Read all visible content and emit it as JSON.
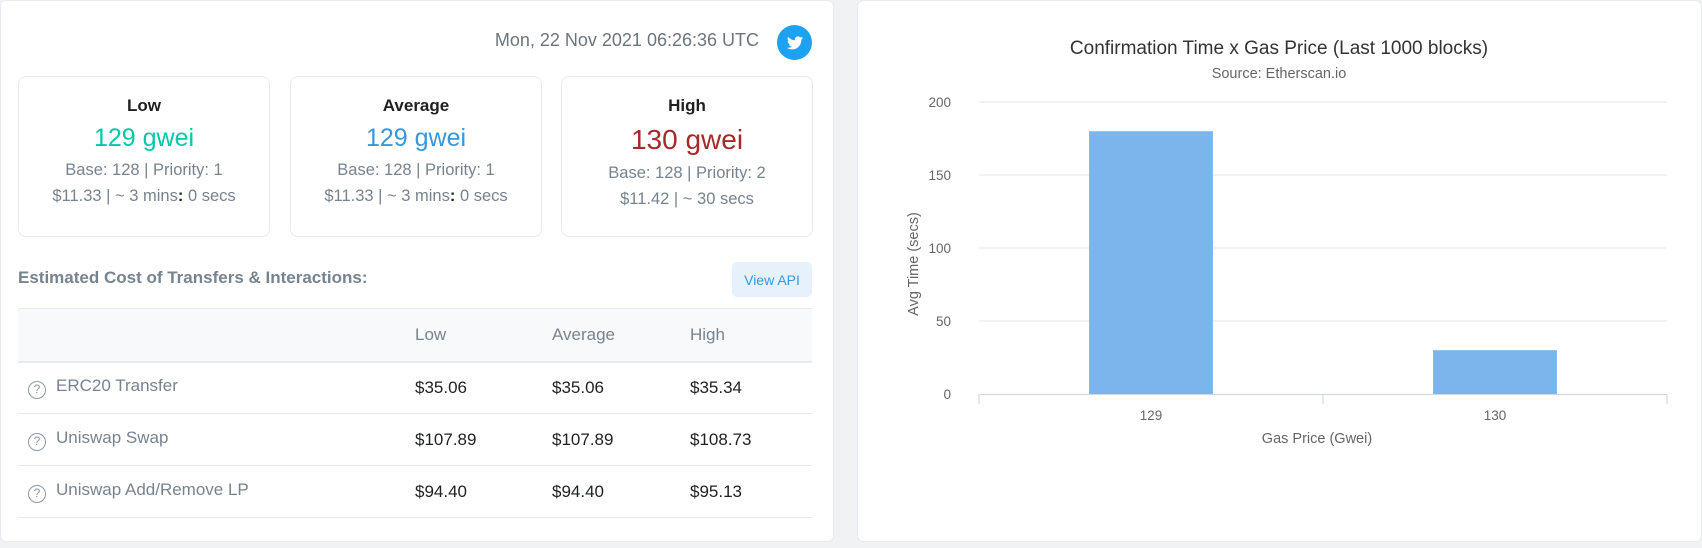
{
  "header": {
    "timestamp": "Mon, 22 Nov 2021 06:26:36 UTC",
    "twitter_icon": "twitter-icon"
  },
  "cards": [
    {
      "title": "Low",
      "value": "129 gwei",
      "detail1": "Base: 128 | Priority: 1",
      "detail2_prefix": "$11.33 | ~ 3 mins",
      "detail2_sep": ":",
      "detail2_suffix": " 0 secs",
      "color": "#00c9a7"
    },
    {
      "title": "Average",
      "value": "129 gwei",
      "detail1": "Base: 128 | Priority: 1",
      "detail2_prefix": "$11.33 | ~ 3 mins",
      "detail2_sep": ":",
      "detail2_suffix": " 0 secs",
      "color": "#3498db"
    },
    {
      "title": "High",
      "value": "130 gwei",
      "detail1": "Base: 128 | Priority: 2",
      "detail2_prefix": "$11.42 | ~ 30 secs",
      "detail2_sep": "",
      "detail2_suffix": "",
      "color": "#a52a2a"
    }
  ],
  "costs": {
    "title": "Estimated Cost of Transfers & Interactions:",
    "api_button": "View API",
    "columns": [
      "",
      "Low",
      "Average",
      "High"
    ],
    "rows": [
      {
        "name": "ERC20 Transfer",
        "low": "$35.06",
        "average": "$35.06",
        "high": "$35.34",
        "icon": "question-circle-icon"
      },
      {
        "name": "Uniswap Swap",
        "low": "$107.89",
        "average": "$107.89",
        "high": "$108.73",
        "icon": "question-circle-icon"
      },
      {
        "name": "Uniswap Add/Remove LP",
        "low": "$94.40",
        "average": "$94.40",
        "high": "$95.13",
        "icon": "question-circle-icon"
      }
    ]
  },
  "chart_data": {
    "type": "bar",
    "title": "Confirmation Time x Gas Price (Last 1000 blocks)",
    "subtitle": "Source: Etherscan.io",
    "xlabel": "Gas Price (Gwei)",
    "ylabel": "Avg Time (secs)",
    "categories": [
      "129",
      "130"
    ],
    "values": [
      180,
      30
    ],
    "ylim": [
      0,
      200
    ],
    "yticks": [
      0,
      50,
      100,
      150,
      200
    ],
    "grid": true,
    "bar_color": "#7cb5ec"
  }
}
